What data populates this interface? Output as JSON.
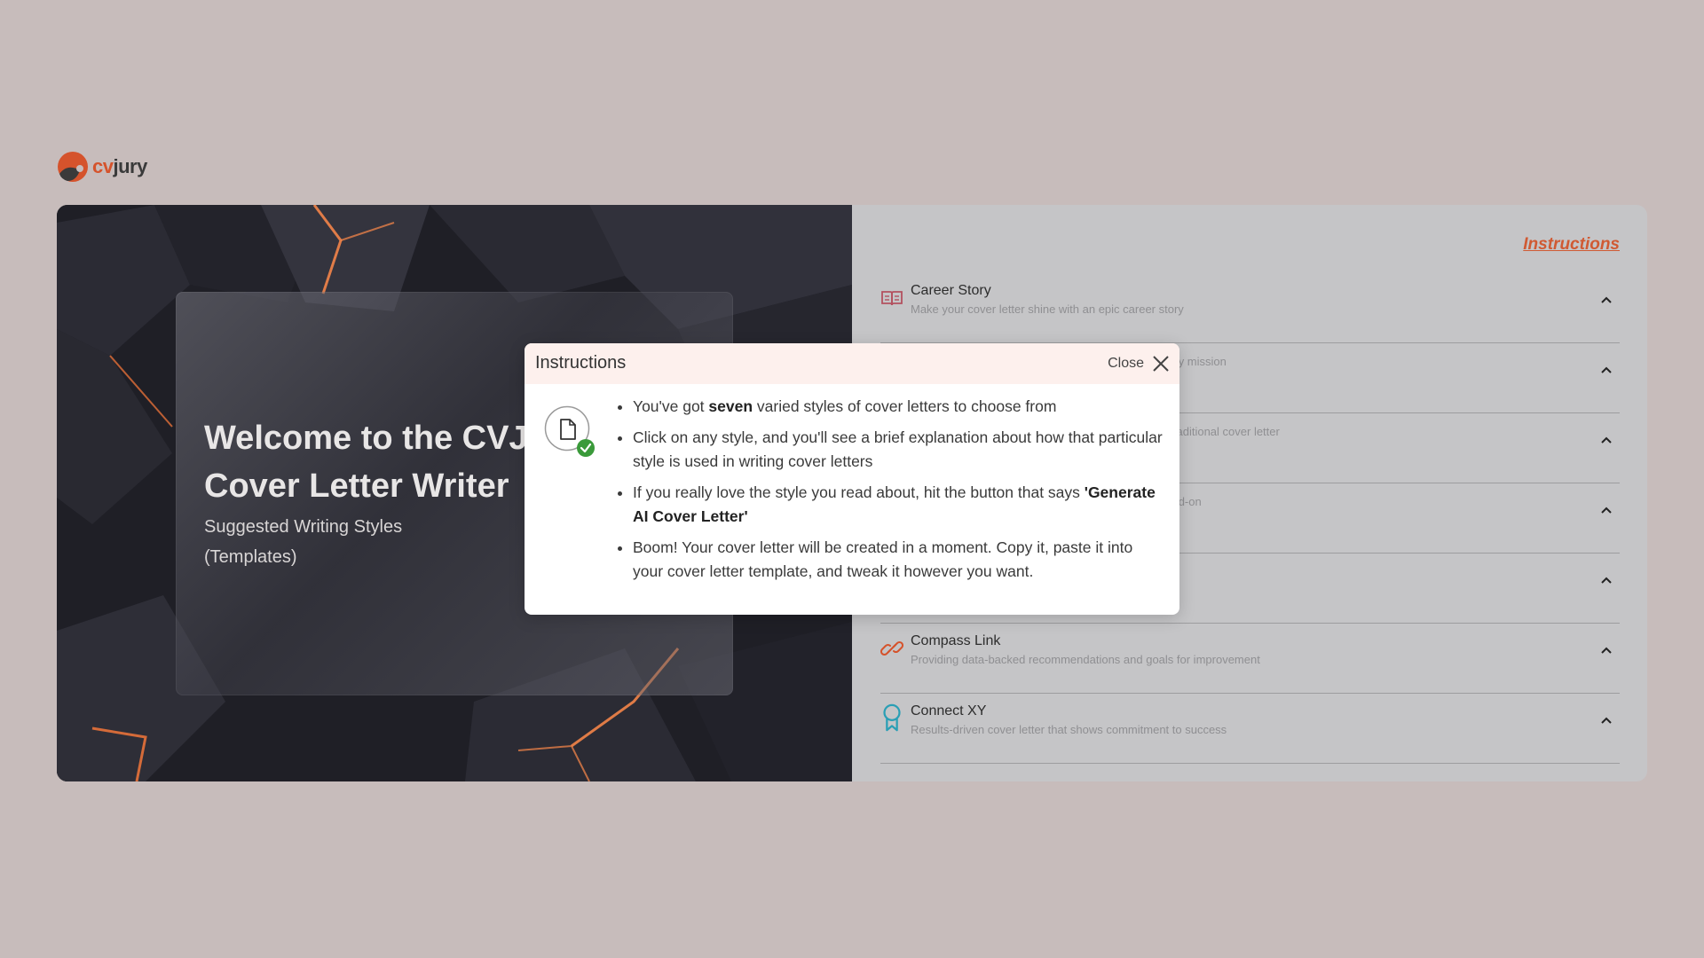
{
  "brand": {
    "logo_cv": "cv",
    "logo_jury": "jury"
  },
  "hero": {
    "title": "Welcome to the CVJury AI Cover Letter Writer",
    "subtitle": "Suggested Writing Styles (Templates)"
  },
  "panel": {
    "instructions_link": "Instructions",
    "styles": [
      {
        "name": "Career Story",
        "desc": "Make your cover letter shine with an epic career story",
        "icon": "book-icon",
        "icon_color": "#b3515f"
      },
      {
        "name": "",
        "desc": "pany mission",
        "icon": "",
        "icon_color": ""
      },
      {
        "name": "",
        "desc": "n-traditional cover letter",
        "icon": "",
        "icon_color": ""
      },
      {
        "name": "",
        "desc": "head-on",
        "icon": "",
        "icon_color": ""
      },
      {
        "name": "",
        "desc": "",
        "icon": "",
        "icon_color": ""
      },
      {
        "name": "Compass Link",
        "desc": "Providing data-backed recommendations and goals for improvement",
        "icon": "link-icon",
        "icon_color": "#d5532c"
      },
      {
        "name": "Connect XY",
        "desc": "Results-driven cover letter that shows commitment to success",
        "icon": "award-icon",
        "icon_color": "#2a9fb5"
      }
    ]
  },
  "modal": {
    "title": "Instructions",
    "close_label": "Close",
    "items": [
      {
        "before": "You've got ",
        "bold": "seven",
        "after": " varied styles of cover letters to choose from"
      },
      {
        "before": "Click on any style, and you'll see a brief explanation about how that particular style is used in writing cover letters",
        "bold": "",
        "after": ""
      },
      {
        "before": "If you really love the style you read about, hit the button that says ",
        "bold": "'Generate AI Cover Letter'",
        "after": ""
      },
      {
        "before": "Boom! Your cover letter will be created in a moment. Copy it, paste it into your cover letter template, and tweak it however you want.",
        "bold": "",
        "after": ""
      }
    ]
  },
  "colors": {
    "accent": "#d5532c",
    "backdrop": "#c7bcbb",
    "modal_header": "#fdf0ed",
    "success": "#3a9a3a"
  }
}
